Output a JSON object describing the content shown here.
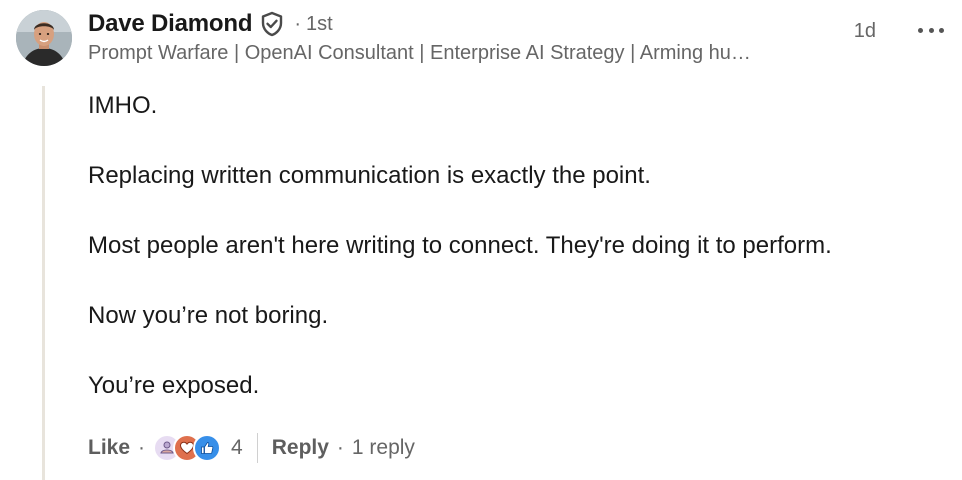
{
  "comment": {
    "author": {
      "name": "Dave Diamond",
      "degree": "1st",
      "separator": "·",
      "headline": "Prompt Warfare | OpenAI Consultant | Enterprise AI Strategy | Arming hu…"
    },
    "timestamp": "1d",
    "body": [
      "IMHO.",
      "Replacing written communication is exactly the point.",
      "Most people aren't here writing to connect. They're doing it to perform.",
      "Now you’re not boring.",
      "You’re exposed."
    ],
    "actions": {
      "like_label": "Like",
      "reply_label": "Reply",
      "reaction_count": "4",
      "reply_count": "1 reply",
      "separator": "·"
    },
    "reaction_icons": [
      "support-icon",
      "love-icon",
      "like-icon"
    ],
    "colors": {
      "text": "#191919",
      "secondary": "#666666",
      "thread_line": "#e8e4dc",
      "like_blue": "#378fe9",
      "love_red": "#df704d",
      "support_purple": "#bba9d1"
    }
  }
}
